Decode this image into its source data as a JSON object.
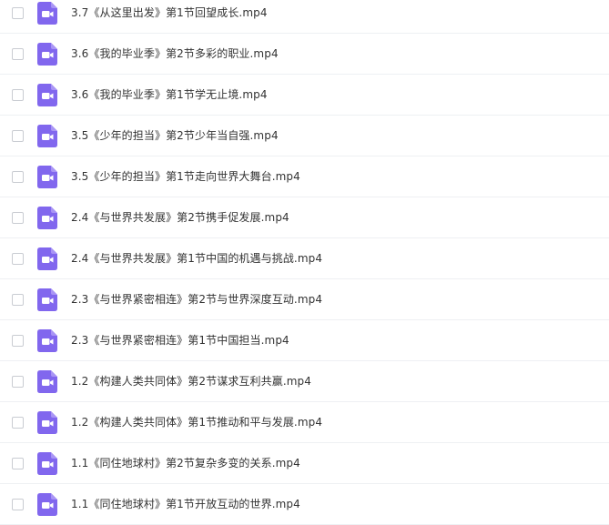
{
  "colors": {
    "icon_bg": "#8167EE",
    "icon_fold": "#A995F5",
    "icon_glyph": "#FFFFFF",
    "text": "#333333",
    "divider": "#EEF0F3",
    "checkbox_border": "#C9CCD2"
  },
  "file_list": {
    "icon_type": "video-file-icon",
    "items": [
      {
        "name": "3.7《从这里出发》第1节回望成长.mp4"
      },
      {
        "name": "3.6《我的毕业季》第2节多彩的职业.mp4"
      },
      {
        "name": "3.6《我的毕业季》第1节学无止境.mp4"
      },
      {
        "name": "3.5《少年的担当》第2节少年当自强.mp4"
      },
      {
        "name": "3.5《少年的担当》第1节走向世界大舞台.mp4"
      },
      {
        "name": "2.4《与世界共发展》第2节携手促发展.mp4"
      },
      {
        "name": "2.4《与世界共发展》第1节中国的机遇与挑战.mp4"
      },
      {
        "name": "2.3《与世界紧密相连》第2节与世界深度互动.mp4"
      },
      {
        "name": "2.3《与世界紧密相连》第1节中国担当.mp4"
      },
      {
        "name": "1.2《构建人类共同体》第2节谋求互利共赢.mp4"
      },
      {
        "name": "1.2《构建人类共同体》第1节推动和平与发展.mp4"
      },
      {
        "name": "1.1《同住地球村》第2节复杂多变的关系.mp4"
      },
      {
        "name": "1.1《同住地球村》第1节开放互动的世界.mp4"
      }
    ]
  }
}
